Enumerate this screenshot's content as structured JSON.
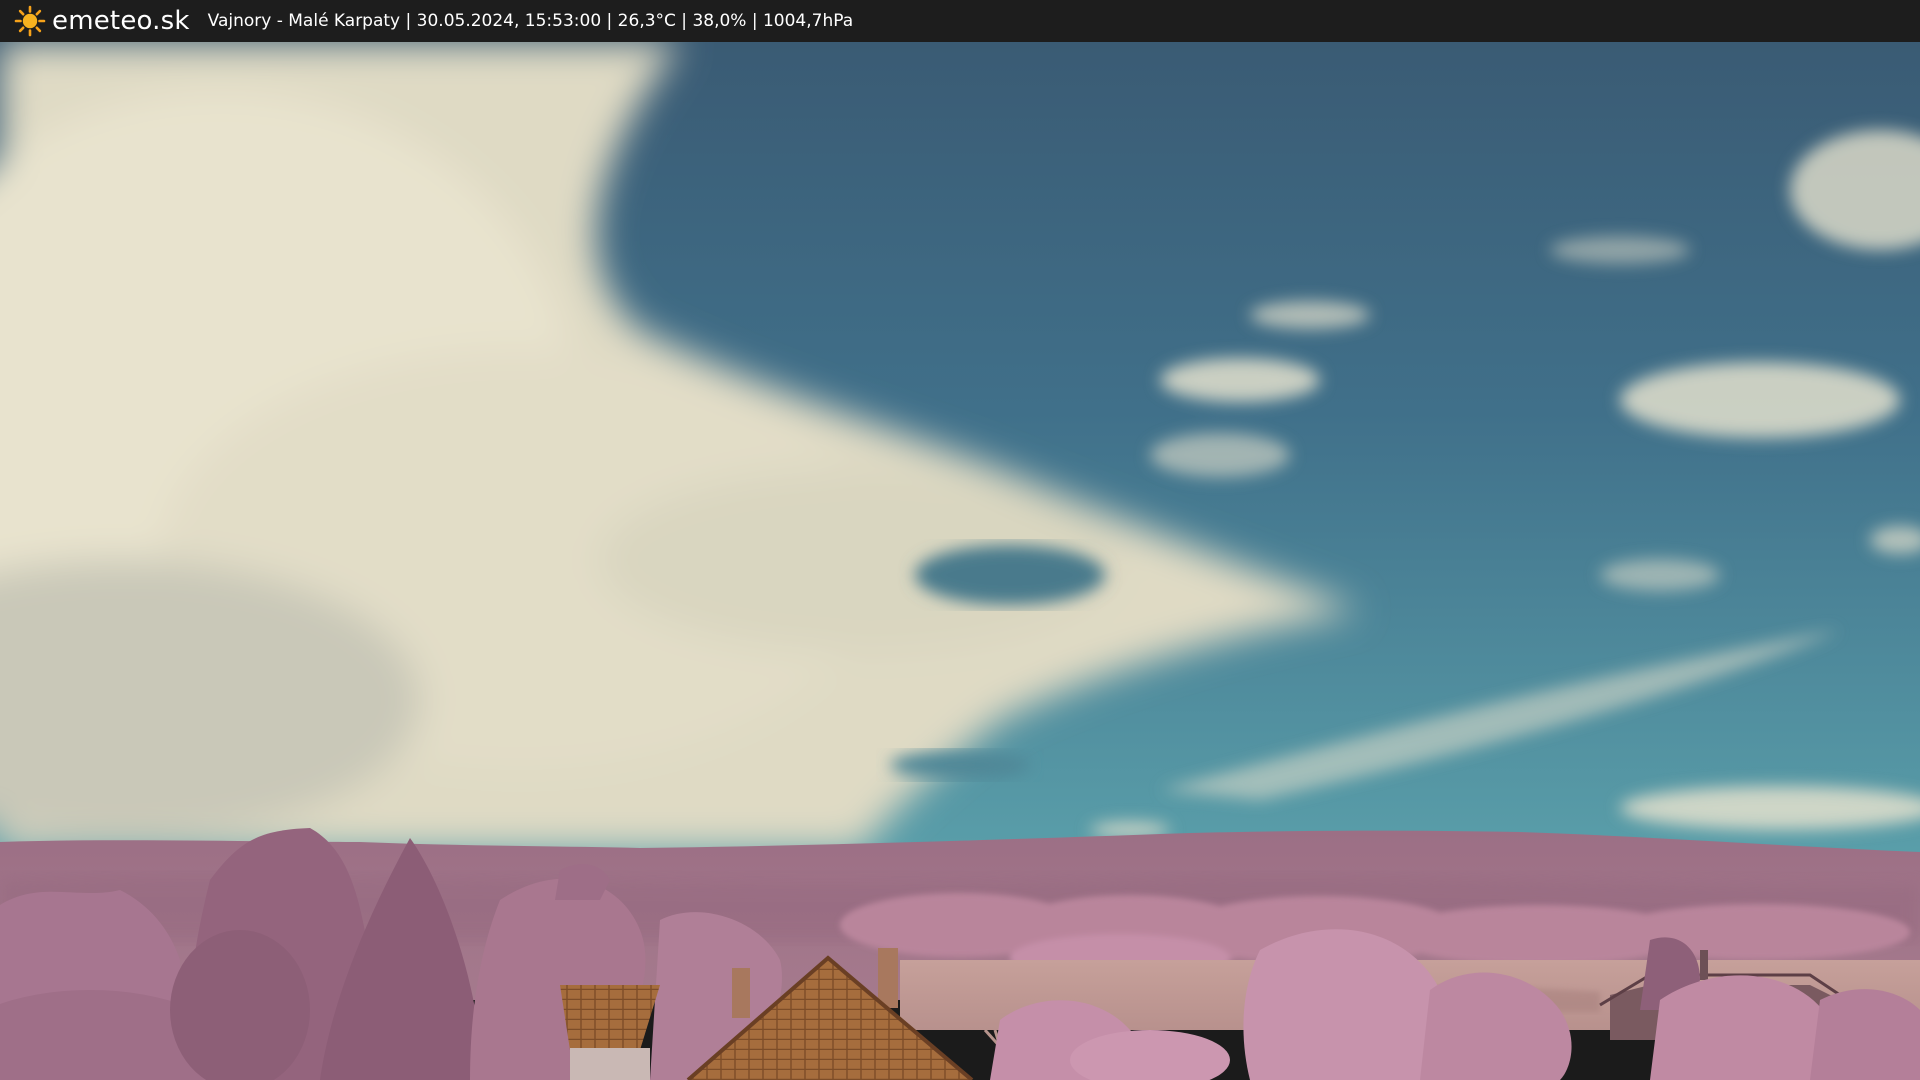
{
  "app": {
    "logo_text": "emeteo.sk",
    "logo_icon": "sun-icon"
  },
  "caption": "Vajnory - Malé Karpaty | 30.05.2024, 15:53:00 | 26,3°C | 38,0% | 1004,7hPa",
  "colors": {
    "topbar": "#1d1d1d",
    "sky_top": "#3b5f78",
    "sky_horizon": "#4f95a3",
    "cloud": "#e6e2cc",
    "foliage": "#b27c97",
    "roof": "#a66e3c"
  }
}
